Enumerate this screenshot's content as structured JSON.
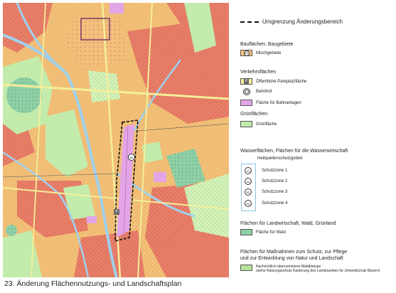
{
  "caption": "23. Änderung Flächennutzungs- und Landschaftsplan",
  "colors": {
    "residential_mixed": "#f3c27a",
    "hatched_residential": "#e9806a",
    "green": "#c3ecac",
    "forest": "#8fcfa5",
    "water": "#9fd1ee",
    "rail": "#e3a5e6",
    "boundary": "#111111",
    "road": "#f4ef9a",
    "protection_zone": "#8cc3e6"
  },
  "legend": {
    "boundary_label": "Umgrenzung Änderungsbereich",
    "building": {
      "heading": "Bauflächen, Baugebiete",
      "mixed_symbol": "MI",
      "mixed_label": "Mischgebiete"
    },
    "traffic": {
      "heading": "Verkehrsflächen",
      "parking_symbol": "P",
      "parking_label": "Öffentliche Parkplatzfläche",
      "station_label": "Bahnhof",
      "rail_label": "Fläche für Bahnanlagen"
    },
    "green": {
      "heading": "Grünflächen",
      "label": "Grünfläche"
    },
    "water": {
      "heading": "Wasserflächen, Flächen für die Wasserwirtschaft",
      "spring_area": "Heilquellenschutzgebiet",
      "zones": [
        {
          "symbol": "1Q",
          "label": "Schutzzone 1"
        },
        {
          "symbol": "2Q",
          "label": "Schutzzone 2"
        },
        {
          "symbol": "3Q",
          "label": "Schutzzone 3"
        },
        {
          "symbol": "4Q",
          "label": "Schutzzone 4"
        }
      ]
    },
    "agriculture": {
      "heading": "Flächen für Landwirtschaft, Wald, Grünland",
      "forest_label": "Fläche für Wald"
    },
    "protection": {
      "heading_line1": "Flächen für Maßnahmen zum Schutz, zur Pflege",
      "heading_line2": "und zur Entwicklung von Natur und Landschaft",
      "note_line1": "Nachrichtlich übernommene Waldbiotope",
      "note_line2": "(siehe Nutzungsschutz Kartierung des Landesamtes für Umweltschutz Bayern)"
    }
  },
  "map": {
    "area_label": "MI",
    "parking_symbol": "P"
  }
}
